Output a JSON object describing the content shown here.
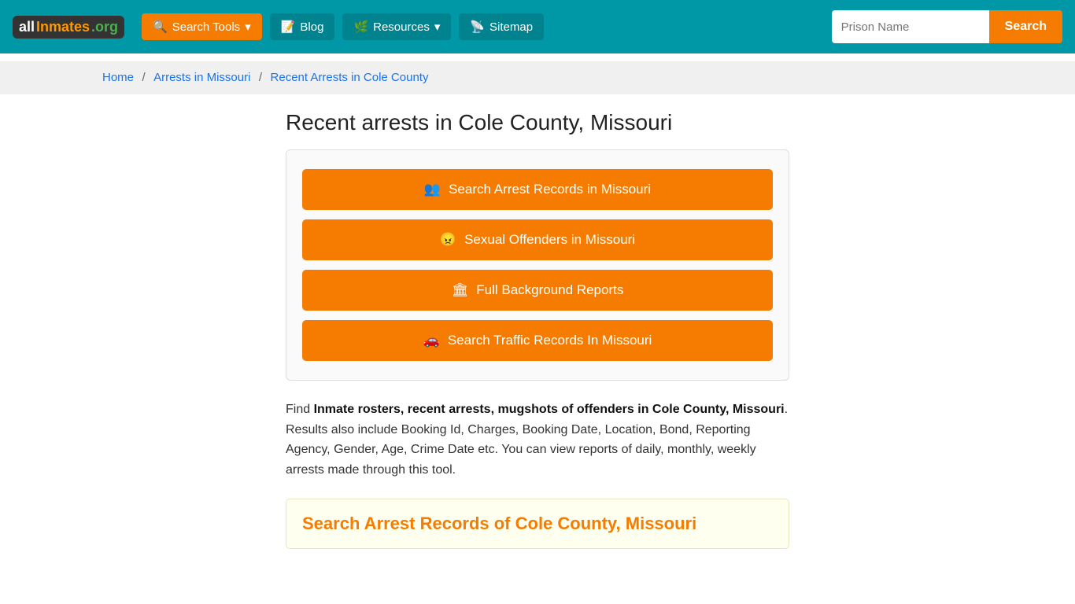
{
  "navbar": {
    "logo": {
      "part1": "all",
      "part2": "Inmates",
      "part3": ".org"
    },
    "nav_items": [
      {
        "id": "search-tools",
        "label": "Search Tools",
        "icon": "🔍",
        "dropdown": true
      },
      {
        "id": "blog",
        "label": "Blog",
        "icon": "📝",
        "dropdown": false
      },
      {
        "id": "resources",
        "label": "Resources",
        "icon": "🌿",
        "dropdown": true
      },
      {
        "id": "sitemap",
        "label": "Sitemap",
        "icon": "📡",
        "dropdown": false
      }
    ],
    "search_placeholder": "Prison Name",
    "search_button": "Search"
  },
  "breadcrumb": {
    "items": [
      {
        "label": "Home",
        "href": "#"
      },
      {
        "label": "Arrests in Missouri",
        "href": "#"
      },
      {
        "label": "Recent Arrests in Cole County",
        "href": "#",
        "current": true
      }
    ]
  },
  "page": {
    "title": "Recent arrests in Cole County, Missouri",
    "buttons": [
      {
        "id": "arrest-records",
        "icon": "👥",
        "label": "Search Arrest Records in Missouri"
      },
      {
        "id": "sexual-offenders",
        "icon": "😠",
        "label": "Sexual Offenders in Missouri"
      },
      {
        "id": "background-reports",
        "icon": "🏛",
        "label": "Full Background Reports"
      },
      {
        "id": "traffic-records",
        "icon": "🚗",
        "label": "Search Traffic Records In Missouri"
      }
    ],
    "description_prefix": "Find ",
    "description_bold": "Inmate rosters, recent arrests, mugshots of offenders in Cole County, Missouri",
    "description_suffix": ". Results also include Booking Id, Charges, Booking Date, Location, Bond, Reporting Agency, Gender, Age, Crime Date etc. You can view reports of daily, monthly, weekly arrests made through this tool.",
    "search_section_title": "Search Arrest Records of Cole County, Missouri"
  }
}
